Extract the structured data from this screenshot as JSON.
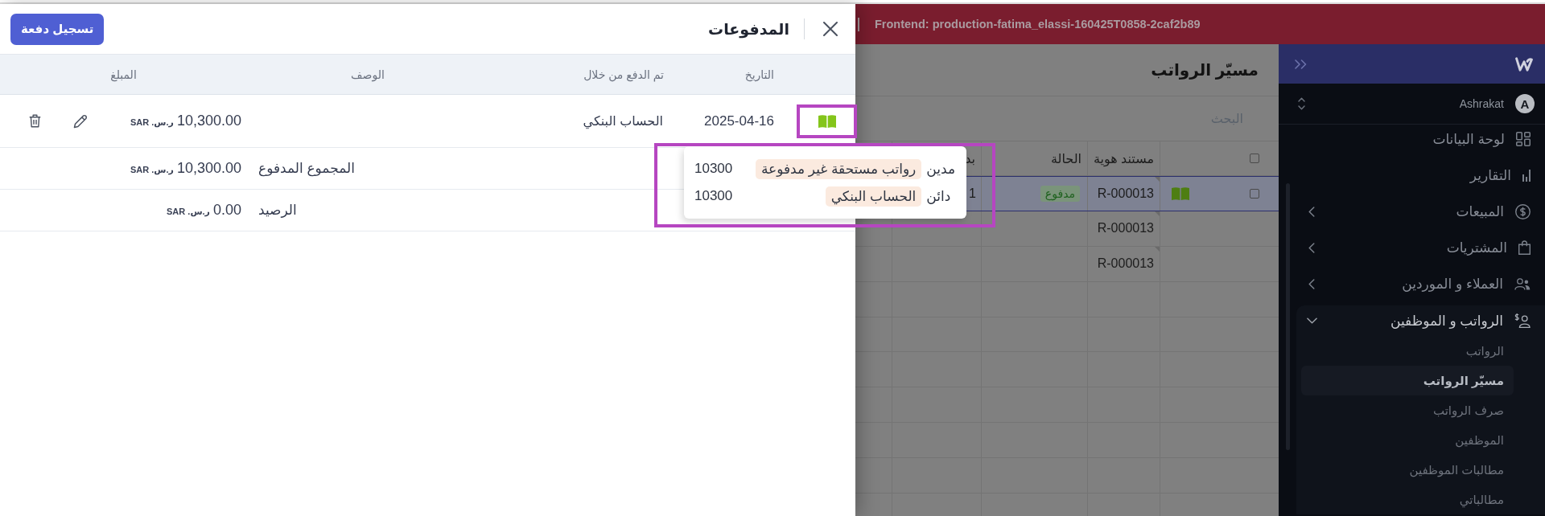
{
  "drawer": {
    "title": "المدفوعات",
    "primary_action": "تسجيل دفعة",
    "columns": [
      "التاريخ",
      "تم الدفع من خلال",
      "الوصف",
      "المبلغ"
    ],
    "payments": [
      {
        "ledger_highlighted": true,
        "date": "2025-04-16",
        "paid_through": "الحساب البنكي",
        "amount": "10,300.00",
        "currency": "ر.س. SAR"
      }
    ],
    "summary": [
      {
        "label": "المجموع المدفوع",
        "amount": "10,300.00",
        "currency": "ر.س. SAR"
      },
      {
        "label": "الرصيد",
        "amount": "0.00",
        "currency": "ر.س. SAR"
      }
    ]
  },
  "ledger_popup": {
    "highlighted": true,
    "entries": [
      {
        "side": "مدين",
        "account": "رواتب مستحقة غير مدفوعة",
        "amount": "10300"
      },
      {
        "side": "دائن",
        "account": "الحساب البنكي",
        "amount": "10300"
      }
    ]
  },
  "environment_bar": {
    "text": "Frontend: production-fatima_elassi-160425T0858-2caf2b89"
  },
  "page": {
    "title": "مسيّر الرواتب",
    "search": {
      "placeholder": "البحث"
    },
    "table": {
      "select_all": {
        "checked": false
      },
      "columns": [
        "مستند هوية",
        "الحالة",
        "بد"
      ],
      "rows": [
        {
          "kind": "record",
          "selected": true,
          "checked": false,
          "document_id": "R-000013",
          "status": "مدفوع",
          "column_3": "1"
        },
        {
          "kind": "detail",
          "selected": false,
          "document_id": "R-000013"
        },
        {
          "kind": "detail",
          "selected": false,
          "document_id": "R-000013"
        }
      ]
    }
  },
  "sidebar": {
    "user": {
      "initial": "A",
      "name": "Ashrakat"
    },
    "items": [
      {
        "label": "لوحة البيانات"
      },
      {
        "label": "التقارير"
      },
      {
        "label": "المبيعات",
        "expanded": false
      },
      {
        "label": "المشتريات",
        "expanded": false
      },
      {
        "label": "العملاء و الموردين",
        "expanded": false
      },
      {
        "label": "الرواتب و الموظفين",
        "expanded": true,
        "children": [
          {
            "label": "الرواتب",
            "selected": false
          },
          {
            "label": "مسيّر الرواتب",
            "selected": true
          },
          {
            "label": "صرف الرواتب",
            "selected": false
          },
          {
            "label": "الموظفين",
            "selected": false
          },
          {
            "label": "مطالبات الموظفين",
            "selected": false
          },
          {
            "label": "مطالباتي",
            "selected": false
          }
        ]
      }
    ]
  }
}
